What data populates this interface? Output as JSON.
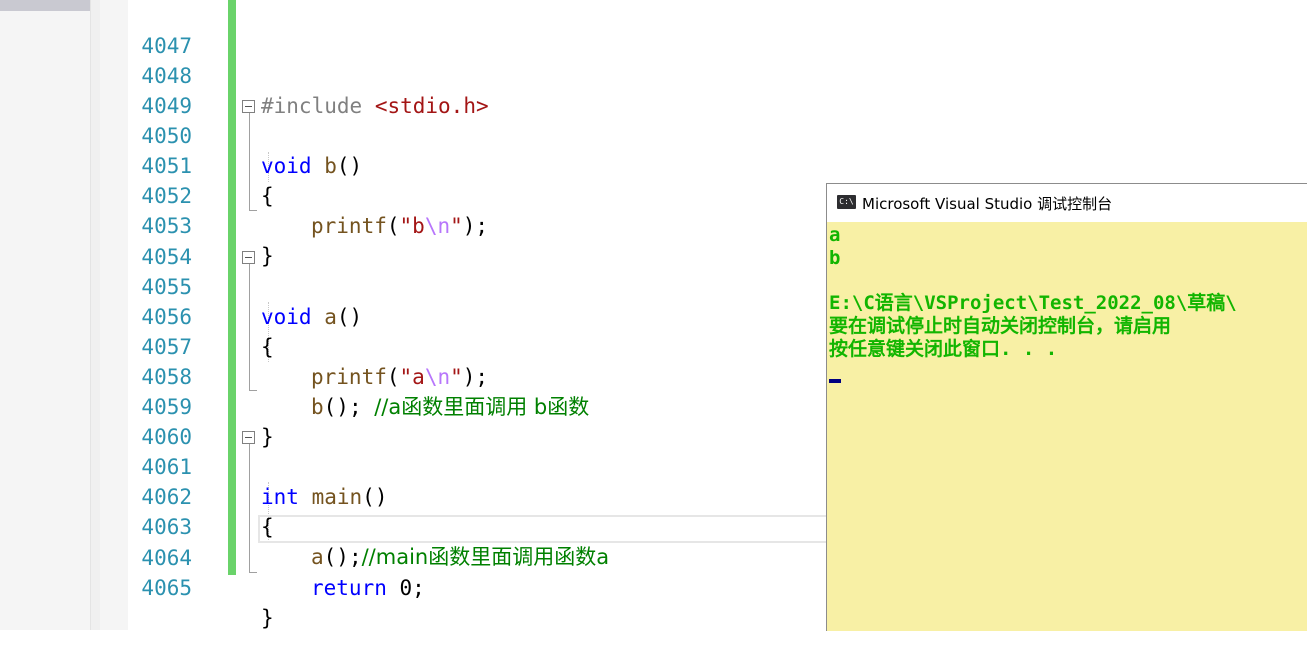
{
  "editor": {
    "lines": [
      {
        "num": "4047",
        "text": ""
      },
      {
        "num": "4048",
        "text": "#include <stdio.h>"
      },
      {
        "num": "4049",
        "text": ""
      },
      {
        "num": "4050",
        "text": "void b()"
      },
      {
        "num": "4051",
        "text": "{"
      },
      {
        "num": "4052",
        "text": "printf(\"b\\n\");"
      },
      {
        "num": "4053",
        "text": "}"
      },
      {
        "num": "4054",
        "text": ""
      },
      {
        "num": "4055",
        "text": "void a()"
      },
      {
        "num": "4056",
        "text": "{"
      },
      {
        "num": "4057",
        "text": "printf(\"a\\n\");"
      },
      {
        "num": "4058",
        "text": "b(); //a函数里面调用 b函数"
      },
      {
        "num": "4059",
        "text": "}"
      },
      {
        "num": "4060",
        "text": ""
      },
      {
        "num": "4061",
        "text": "int main()"
      },
      {
        "num": "4062",
        "text": "{"
      },
      {
        "num": "4063",
        "text": "a();//main函数里面调用函数a"
      },
      {
        "num": "4064",
        "text": "return 0;"
      },
      {
        "num": "4065",
        "text": "}"
      }
    ],
    "tokens": {
      "include_kw": "#include",
      "include_file": "<stdio.h>",
      "void_kw": "void",
      "int_kw": "int",
      "return_kw": "return",
      "func_b": "b",
      "func_a": "a",
      "func_main": "main",
      "printf": "printf",
      "comment_a": "//a函数里面调用 b函数",
      "comment_main": "//main函数里面调用函数a"
    }
  },
  "console": {
    "icon_text": "C:\\",
    "title": "Microsoft Visual Studio 调试控制台",
    "output": [
      "a",
      "b",
      "",
      "E:\\C语言\\VSProject\\Test_2022_08\\草稿\\",
      "要在调试停止时自动关闭控制台，请启用",
      "按任意键关闭此窗口. . ."
    ]
  },
  "colors": {
    "line_number": "#2b91af",
    "keyword": "#0000ff",
    "function": "#74531f",
    "string": "#a31515",
    "escape": "#b776fb",
    "comment": "#008000",
    "console_bg": "#f8f0a5",
    "console_text": "#12b500",
    "change_bar": "#6ad36a"
  }
}
